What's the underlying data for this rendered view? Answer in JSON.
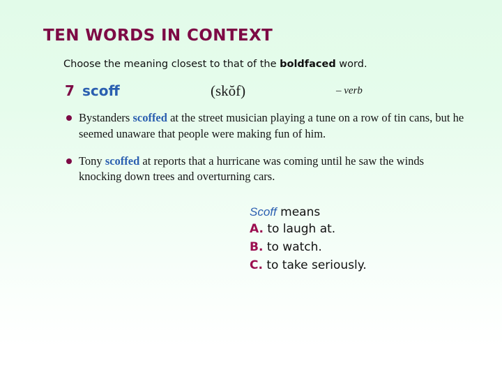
{
  "slide": {
    "title": "TEN WORDS IN CONTEXT",
    "instruction_pre": "Choose the meaning closest to that of the ",
    "instruction_bold": "boldfaced",
    "instruction_post": " word.",
    "background_top_color": "#e2fbe9",
    "background_bottom_color": "#ffffff",
    "accent_maroon": "#7d0a45",
    "accent_blue": "#2b5fb0"
  },
  "entry": {
    "number": "7",
    "word": "scoff",
    "pronunciation": "(skŏf)",
    "part_of_speech": "– verb"
  },
  "examples": [
    {
      "pre": "Bystanders ",
      "keyword": "scoffed",
      "post": " at the street musician playing a tune on a row of tin cans, but he seemed unaware that people were making fun of him."
    },
    {
      "pre": "Tony ",
      "keyword": "scoffed",
      "post": " at reports that a hurricane was coming until he saw the winds knocking down trees and overturning cars."
    }
  ],
  "answers": {
    "prompt_term": "Scoff",
    "prompt_rest": " means",
    "options": [
      {
        "letter": "A.",
        "text": " to laugh at."
      },
      {
        "letter": "B.",
        "text": " to watch."
      },
      {
        "letter": "C.",
        "text": " to take seriously."
      }
    ]
  }
}
